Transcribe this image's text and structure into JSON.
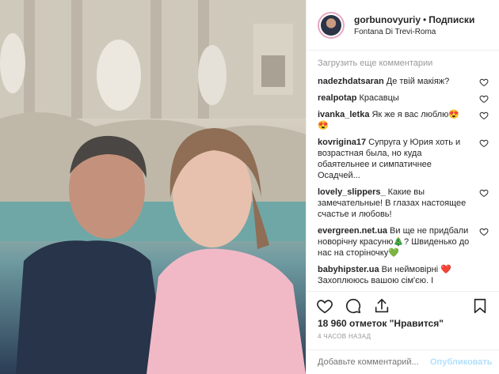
{
  "header": {
    "username": "gorbunovyuriy",
    "separator": "•",
    "follow_label": "Подписки",
    "location": "Fontana Di Trevi-Roma"
  },
  "comments_section": {
    "load_more": "Загрузить еще комментарии",
    "items": [
      {
        "user": "nadezhdatsaran",
        "text": "Де твій макіяж?"
      },
      {
        "user": "realpotap",
        "text": "Красавцы"
      },
      {
        "user": "ivanka_letka",
        "text": "Як же я вас люблю😍 😍"
      },
      {
        "user": "kovrigina17",
        "text": "Супруга у Юрия хоть и возрастная была, но куда обаятельнее и симпатичнее Осадчей..."
      },
      {
        "user": "lovely_slippers_",
        "text": "Какие вы замечательные! В глазах настоящее счастье и любовь!"
      },
      {
        "user": "evergreen.net.ua",
        "text": "Ви ще не придбали новорічну красуню🎄? Швиденько до нас на сторіночку💚"
      },
      {
        "user": "babyhipster.ua",
        "text": "Ви неймовірні ❤️ Захоплююсь вашою сім'єю. І щаслива, що маємо можливість"
      }
    ]
  },
  "actions": {
    "icons": [
      "heart-icon",
      "comment-icon",
      "share-icon",
      "bookmark-icon"
    ]
  },
  "likes_text": "18 960 отметок \"Нравится\"",
  "time_ago": "4 ЧАСОВ НАЗАД",
  "add_comment": {
    "placeholder": "Добавьте комментарий...",
    "publish_label": "Опубликовать"
  }
}
